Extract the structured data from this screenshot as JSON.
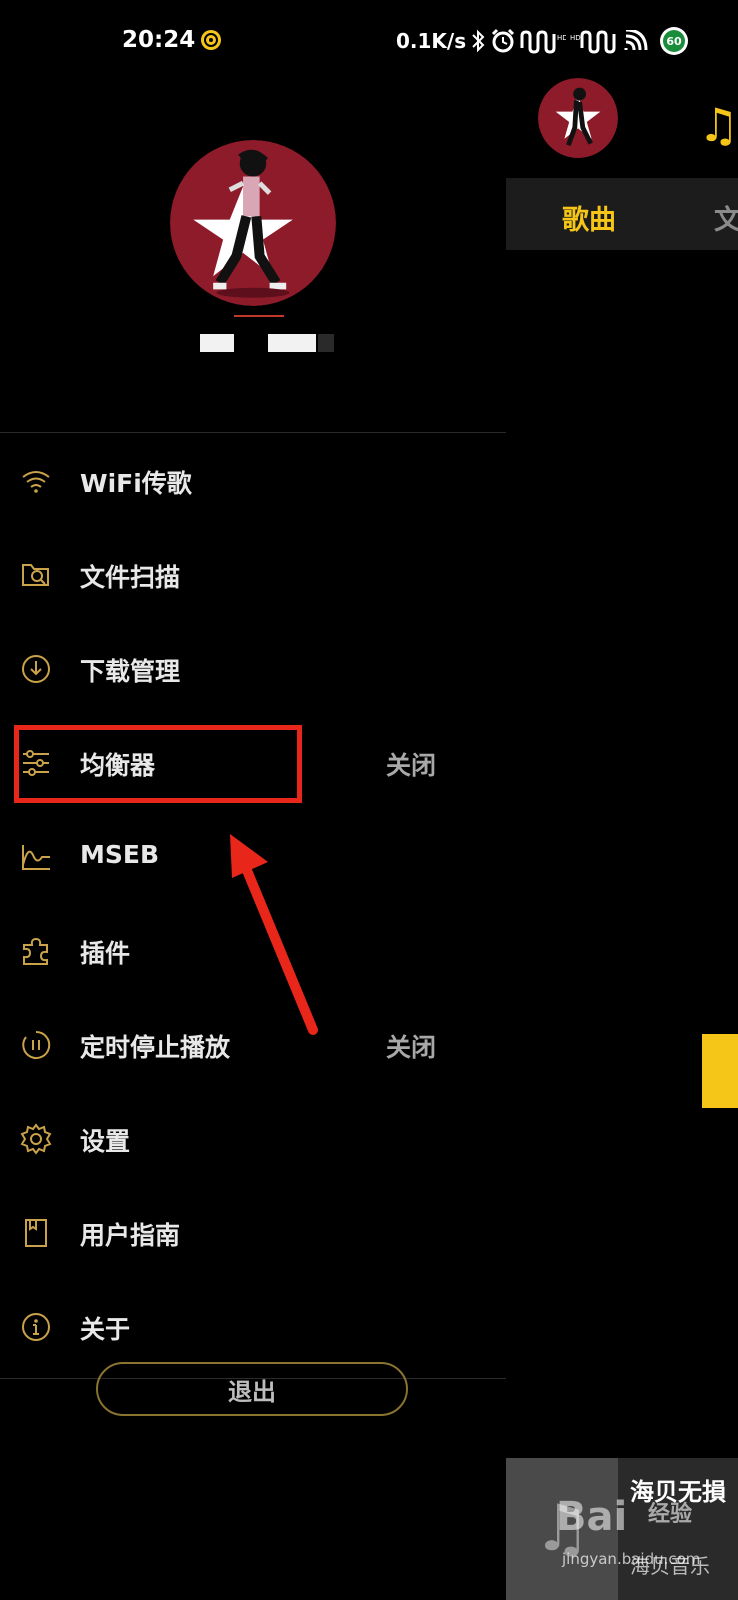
{
  "status_bar": {
    "time": "20:24",
    "speed": "0.1K/s",
    "battery": "60",
    "icons": [
      "bluetooth-icon",
      "alarm-icon",
      "signal-hd-icon",
      "signal-hd-icon",
      "wifi-icon"
    ]
  },
  "drawer": {
    "username": "██ ███",
    "menu": [
      {
        "id": "wifi",
        "label": "WiFi传歌",
        "icon": "wifi-icon",
        "value": ""
      },
      {
        "id": "scan",
        "label": "文件扫描",
        "icon": "folder-search-icon",
        "value": ""
      },
      {
        "id": "download",
        "label": "下载管理",
        "icon": "download-icon",
        "value": ""
      },
      {
        "id": "equalizer",
        "label": "均衡器",
        "icon": "equalizer-sliders-icon",
        "value": "关闭"
      },
      {
        "id": "mseb",
        "label": "MSEB",
        "icon": "waveform-icon",
        "value": ""
      },
      {
        "id": "plugins",
        "label": "插件",
        "icon": "puzzle-icon",
        "value": ""
      },
      {
        "id": "timer",
        "label": "定时停止播放",
        "icon": "timer-pause-icon",
        "value": "关闭"
      },
      {
        "id": "settings",
        "label": "设置",
        "icon": "gear-icon",
        "value": ""
      },
      {
        "id": "guide",
        "label": "用户指南",
        "icon": "book-icon",
        "value": ""
      },
      {
        "id": "about",
        "label": "关于",
        "icon": "info-icon",
        "value": ""
      }
    ],
    "logout_label": "退出"
  },
  "main": {
    "tab_songs": "歌曲",
    "tab_next": "文",
    "now_playing_title": "海贝无損",
    "now_playing_artist": "海贝音乐"
  },
  "watermark": {
    "logo": "Bai",
    "jingyan": "经验",
    "url": "jingyan.baidu.com"
  },
  "colors": {
    "accent": "#f5c518",
    "icon_gold": "#c9a24a",
    "annotation_red": "#e8261a",
    "avatar_bg": "#8e1b2a"
  }
}
